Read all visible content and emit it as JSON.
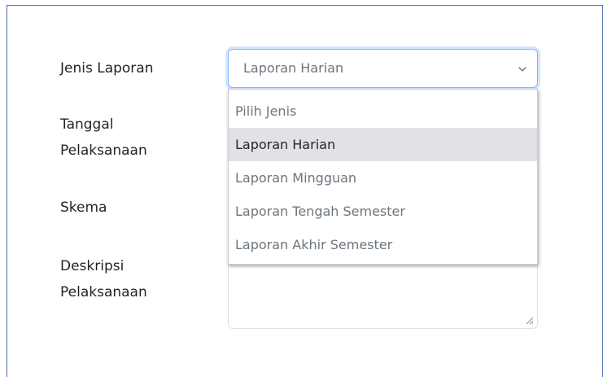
{
  "form": {
    "labels": {
      "jenis": "Jenis Laporan",
      "tanggal": "Tanggal Pelaksanaan",
      "skema": "Skema",
      "deskripsi": "Deskripsi Pelaksanaan"
    },
    "jenis_select": {
      "value": "Laporan Harian",
      "options": [
        "Pilih Jenis",
        "Laporan Harian",
        "Laporan Mingguan",
        "Laporan Tengah Semester",
        "Laporan Akhir Semester"
      ],
      "selected_index": 1
    }
  },
  "icons": {
    "select_chevron": "chevron-down-icon",
    "textarea_resize": "resize-grip-icon"
  },
  "colors": {
    "frame_border": "#4a6fb4",
    "focus_border": "#86b7fe",
    "option_highlight": "#e2e1e6",
    "muted_text": "#6c757d"
  }
}
